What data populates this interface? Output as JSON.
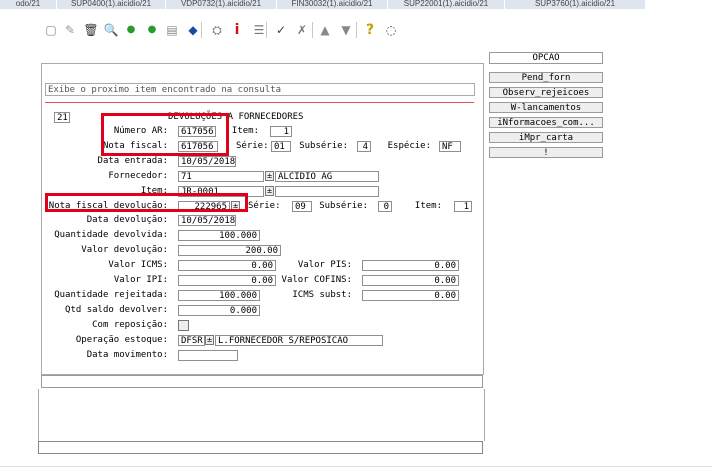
{
  "tabs": [
    "odo/21",
    "SUP0400(1).aicidio/21",
    "VDP0732(1).aicidio/21",
    "FIN30032(1).aicidio/21",
    "SUP22001(1).aicidio/21",
    "SUP3760(1).aicidio/21"
  ],
  "toolbar_icons": [
    "new-icon",
    "edit-icon",
    "delete-icon",
    "find-icon",
    "first-icon",
    "previous-icon",
    "print-icon",
    "save-icon",
    "binoculars-icon",
    "info-icon",
    "list-icon",
    "check-icon",
    "cancel-icon",
    "triangle-up-icon",
    "triangle-down-icon",
    "help-icon",
    "comment-icon"
  ],
  "toolbar_glyphs": [
    "▢",
    "✎",
    "🗑",
    "🔍",
    "●",
    "●",
    "▤",
    "◆",
    "⛭",
    "i",
    "☰",
    "✓",
    "✗",
    "▲",
    "▼",
    "?",
    "◌"
  ],
  "status_message": "Exibe o proximo item encontrado na consulta",
  "form": {
    "company": "21",
    "title": "DEVOLUÇÕES A FORNECEDORES",
    "numero_ar_label": "Número AR:",
    "numero_ar": "617056",
    "item_label": "Item:",
    "item": "1",
    "nota_fiscal_label": "Nota fiscal:",
    "nota_fiscal": "617056",
    "serie_label": "Série:",
    "serie": "01",
    "subserie_label": "Subsérie:",
    "subserie": "4",
    "especie_label": "Espécie:",
    "especie": "NF",
    "data_entrada_label": "Data entrada:",
    "data_entrada": "10/05/2018",
    "fornecedor_label": "Fornecedor:",
    "fornecedor": "71",
    "fornecedor_nome": "ALCIDIO AG",
    "item2_label": "Item:",
    "item2": "JR-0001",
    "nf_devolucao_label": "Nota fiscal devolução:",
    "nf_devolucao": "222965",
    "serie_dev_label": "Série:",
    "serie_dev": "09",
    "subserie_dev_label": "Subsérie:",
    "subserie_dev": "0",
    "item_dev_label": "Item:",
    "item_dev": "1",
    "data_devolucao_label": "Data devolução:",
    "data_devolucao": "10/05/2018",
    "qtd_devolvida_label": "Quantidade devolvida:",
    "qtd_devolvida": "100.000",
    "valor_devolucao_label": "Valor devolução:",
    "valor_devolucao": "200.00",
    "valor_icms_label": "Valor ICMS:",
    "valor_icms": "0.00",
    "valor_pis_label": "Valor PIS:",
    "valor_pis": "0.00",
    "valor_ipi_label": "Valor IPI:",
    "valor_ipi": "0.00",
    "valor_cofins_label": "Valor COFINS:",
    "valor_cofins": "0.00",
    "qtd_rejeitada_label": "Quantidade rejeitada:",
    "qtd_rejeitada": "100.000",
    "icms_subst_label": "ICMS subst:",
    "icms_subst": "0.00",
    "qtd_saldo_label": "Qtd saldo devolver:",
    "qtd_saldo": "0.000",
    "com_reposicao_label": "Com reposição:",
    "operacao_label": "Operação estoque:",
    "operacao": "DFSR",
    "operacao_desc": "L.FORNECEDOR S/REPOSICAO",
    "data_movimento_label": "Data movimento:",
    "data_movimento": ""
  },
  "side_menu": {
    "title": "OPCAO",
    "buttons": [
      "Pend_forn",
      "Observ_rejeicoes",
      "W-lancamentos",
      "iNformacoes_com...",
      "iMpr_carta",
      "!"
    ]
  },
  "colors": {
    "highlight": "#e0001a",
    "separator": "#e05050",
    "tab_bg": "#dfe5ee"
  }
}
